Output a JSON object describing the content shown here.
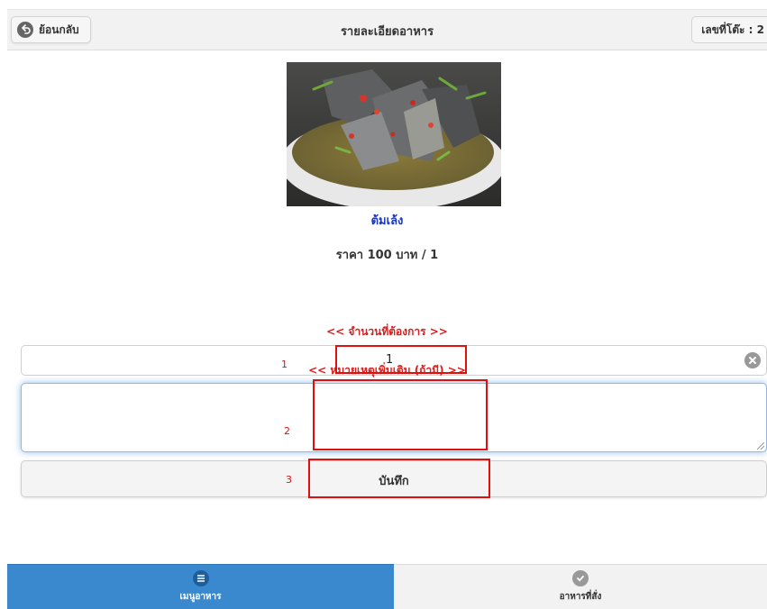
{
  "header": {
    "back_label": "ย้อนกลับ",
    "title": "รายละเอียดอาหาร",
    "table_label": "เลขที่โต๊ะ : 2"
  },
  "food": {
    "name": "ต้มเล้ง",
    "price": "ราคา 100 บาท / 1"
  },
  "form": {
    "qty_label": "<< จำนวนที่ต้องการ >>",
    "qty_value": "1",
    "note_label": "<< หมายเหตุเพิ่มเติม (ถ้ามี) >>",
    "note_value": "",
    "save_label": "บันทึก"
  },
  "annotations": {
    "n1": "1",
    "n2": "2",
    "n3": "3"
  },
  "footer": {
    "tabs": [
      {
        "label": "เมนูอาหาร",
        "icon": "list-icon",
        "active": true
      },
      {
        "label": "อาหารที่สั่ง",
        "icon": "check-circle-icon",
        "active": false
      }
    ]
  },
  "colors": {
    "accent": "#3a88cd",
    "title_link": "#1a36c4",
    "label_red": "#d82020",
    "callout": "#e01010"
  }
}
